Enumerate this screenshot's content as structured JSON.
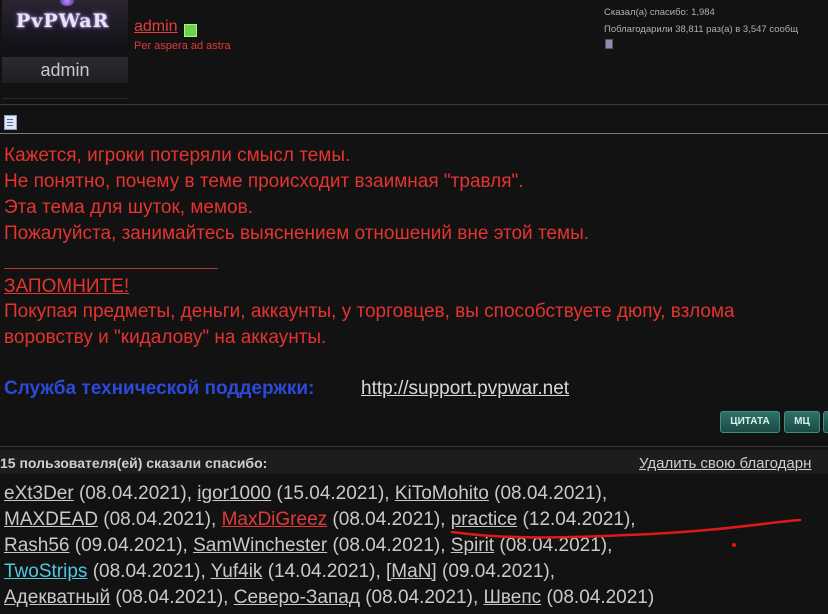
{
  "post": {
    "logo_text": "PvPWaR",
    "avatar_name": "admin",
    "username": "admin",
    "motto": "Per aspera ad astra",
    "stats": [
      "Сказал(а) спасибо: 1,984",
      "Поблагодарили 38,811 раз(а) в 3,547 сообщ"
    ],
    "message_lines": [
      "Кажется, игроки потеряли смысл темы.",
      "Не понятно, почему в теме происходит взаимная \"травля\".",
      "Эта тема для шуток, мемов.",
      "Пожалуйста, занимайтесь выяснением отношений вне этой темы."
    ],
    "remember": "ЗАПОМНИТЕ!",
    "warning_lines": [
      "Покупая предметы, деньги, аккаунты, у торговцев, вы способствуете дюпу, взлома",
      "воровству и \"кидалову\" на аккаунты."
    ],
    "support_label": "Служба технической поддержки:",
    "support_link": "http://support.pvpwar.net"
  },
  "buttons": {
    "quote": "ЦИТАТА",
    "mq": "МЦ"
  },
  "thanks": {
    "title": "15 пользователя(ей) сказали спасибо:",
    "remove": "Удалить свою благодарн",
    "rows": [
      [
        {
          "name": "eXt3Der",
          "color": "#c9c9c9",
          "date": " (08.04.2021), "
        },
        {
          "name": "igor1000",
          "color": "#c9c9c9",
          "date": " (15.04.2021), "
        },
        {
          "name": "KiToMohito",
          "color": "#c9c9c9",
          "date": " (08.04.2021),"
        }
      ],
      [
        {
          "name": "MAXDEAD",
          "color": "#c9c9c9",
          "date": " (08.04.2021), "
        },
        {
          "name": "MaxDiGreez",
          "color": "#e23a3a",
          "date": " (08.04.2021), "
        },
        {
          "name": "practice",
          "color": "#c9c9c9",
          "date": " (12.04.2021),"
        }
      ],
      [
        {
          "name": "Rash56",
          "color": "#c9c9c9",
          "date": " (09.04.2021), "
        },
        {
          "name": "SamWinchester",
          "color": "#c9c9c9",
          "date": " (08.04.2021), "
        },
        {
          "name": "Spirit",
          "color": "#c9c9c9",
          "date": " (08.04.2021),"
        }
      ],
      [
        {
          "name": "TwoStrips",
          "color": "#4fc8e0",
          "date": " (08.04.2021), "
        },
        {
          "name": "Yuf4ik",
          "color": "#c9c9c9",
          "date": " (14.04.2021), "
        },
        {
          "name": "[MaN]",
          "color": "#c9c9c9",
          "date": " (09.04.2021),"
        }
      ],
      [
        {
          "name": "Адекватный",
          "color": "#c9c9c9",
          "date": " (08.04.2021), "
        },
        {
          "name": "Северо-Запад",
          "color": "#c9c9c9",
          "date": " (08.04.2021), "
        },
        {
          "name": "Швепс",
          "color": "#c9c9c9",
          "date": " (08.04.2021)"
        }
      ]
    ]
  },
  "colors": {
    "alert_red": "#e3342f",
    "support_blue": "#2c49d8",
    "button_teal": "#2f7168"
  }
}
